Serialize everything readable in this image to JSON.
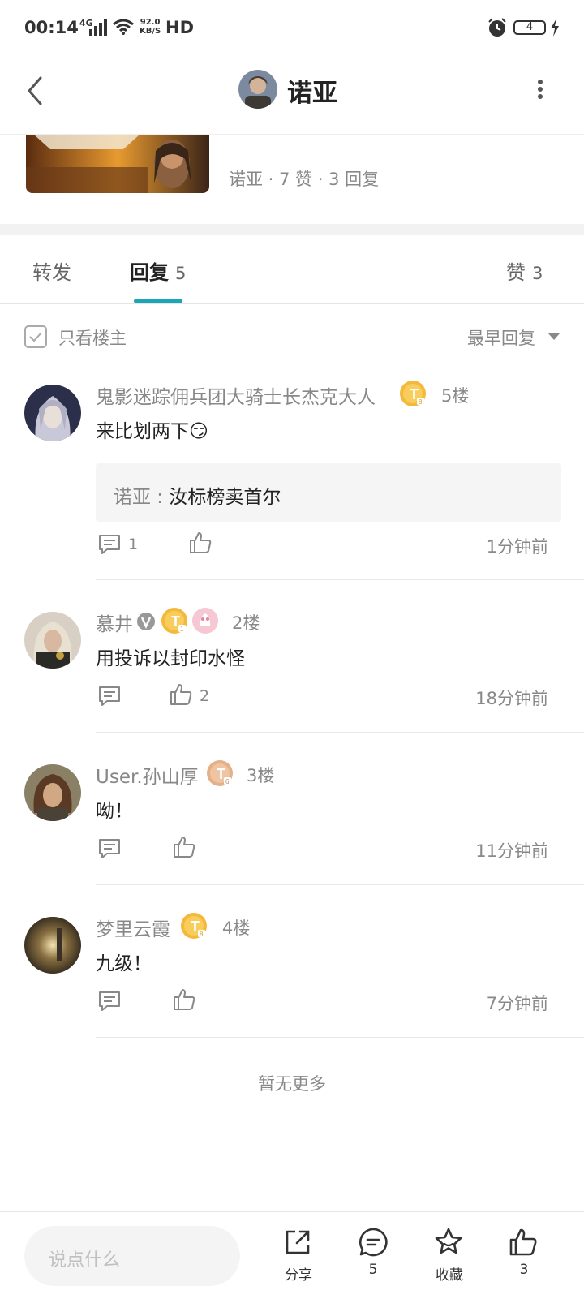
{
  "status_bar": {
    "time": "00:14",
    "network": "4G",
    "speed_top": "92.0",
    "speed_unit": "KB/S",
    "hd": "HD",
    "battery": "4"
  },
  "header": {
    "title": "诺亚"
  },
  "post": {
    "meta": "诺亚 · 7 赞 · 3 回复"
  },
  "tabs": [
    {
      "label": "转发",
      "count": ""
    },
    {
      "label": "回复",
      "count": "5"
    },
    {
      "label": "赞",
      "count": "3"
    }
  ],
  "filter": {
    "only_owner": "只看楼主",
    "sort": "最早回复"
  },
  "comments": [
    {
      "user": "鬼影迷踪佣兵团大骑士长杰克大人",
      "floor": "5楼",
      "text": "来比划两下😏",
      "quote_name": "诺亚",
      "quote_body": "汝标榜卖首尔",
      "reply_count": "1",
      "like_count": "",
      "time": "1分钟前"
    },
    {
      "user": "慕井",
      "floor": "2楼",
      "text": "用投诉以封印水怪",
      "reply_count": "",
      "like_count": "2",
      "time": "18分钟前"
    },
    {
      "user": "User.孙山厚",
      "floor": "3楼",
      "text": "呦！",
      "reply_count": "",
      "like_count": "",
      "time": "11分钟前"
    },
    {
      "user": "梦里云霞",
      "floor": "4楼",
      "text": "九级！",
      "reply_count": "",
      "like_count": "",
      "time": "7分钟前"
    }
  ],
  "footer_text": "暂无更多",
  "bottom_bar": {
    "input_placeholder": "说点什么",
    "share_label": "分享",
    "comment_count": "5",
    "favorite_label": "收藏",
    "like_count": "3"
  },
  "colors": {
    "accent": "#1aa6b7",
    "badge_gold": "#f4b93a",
    "badge_bronze": "#e4b088"
  }
}
